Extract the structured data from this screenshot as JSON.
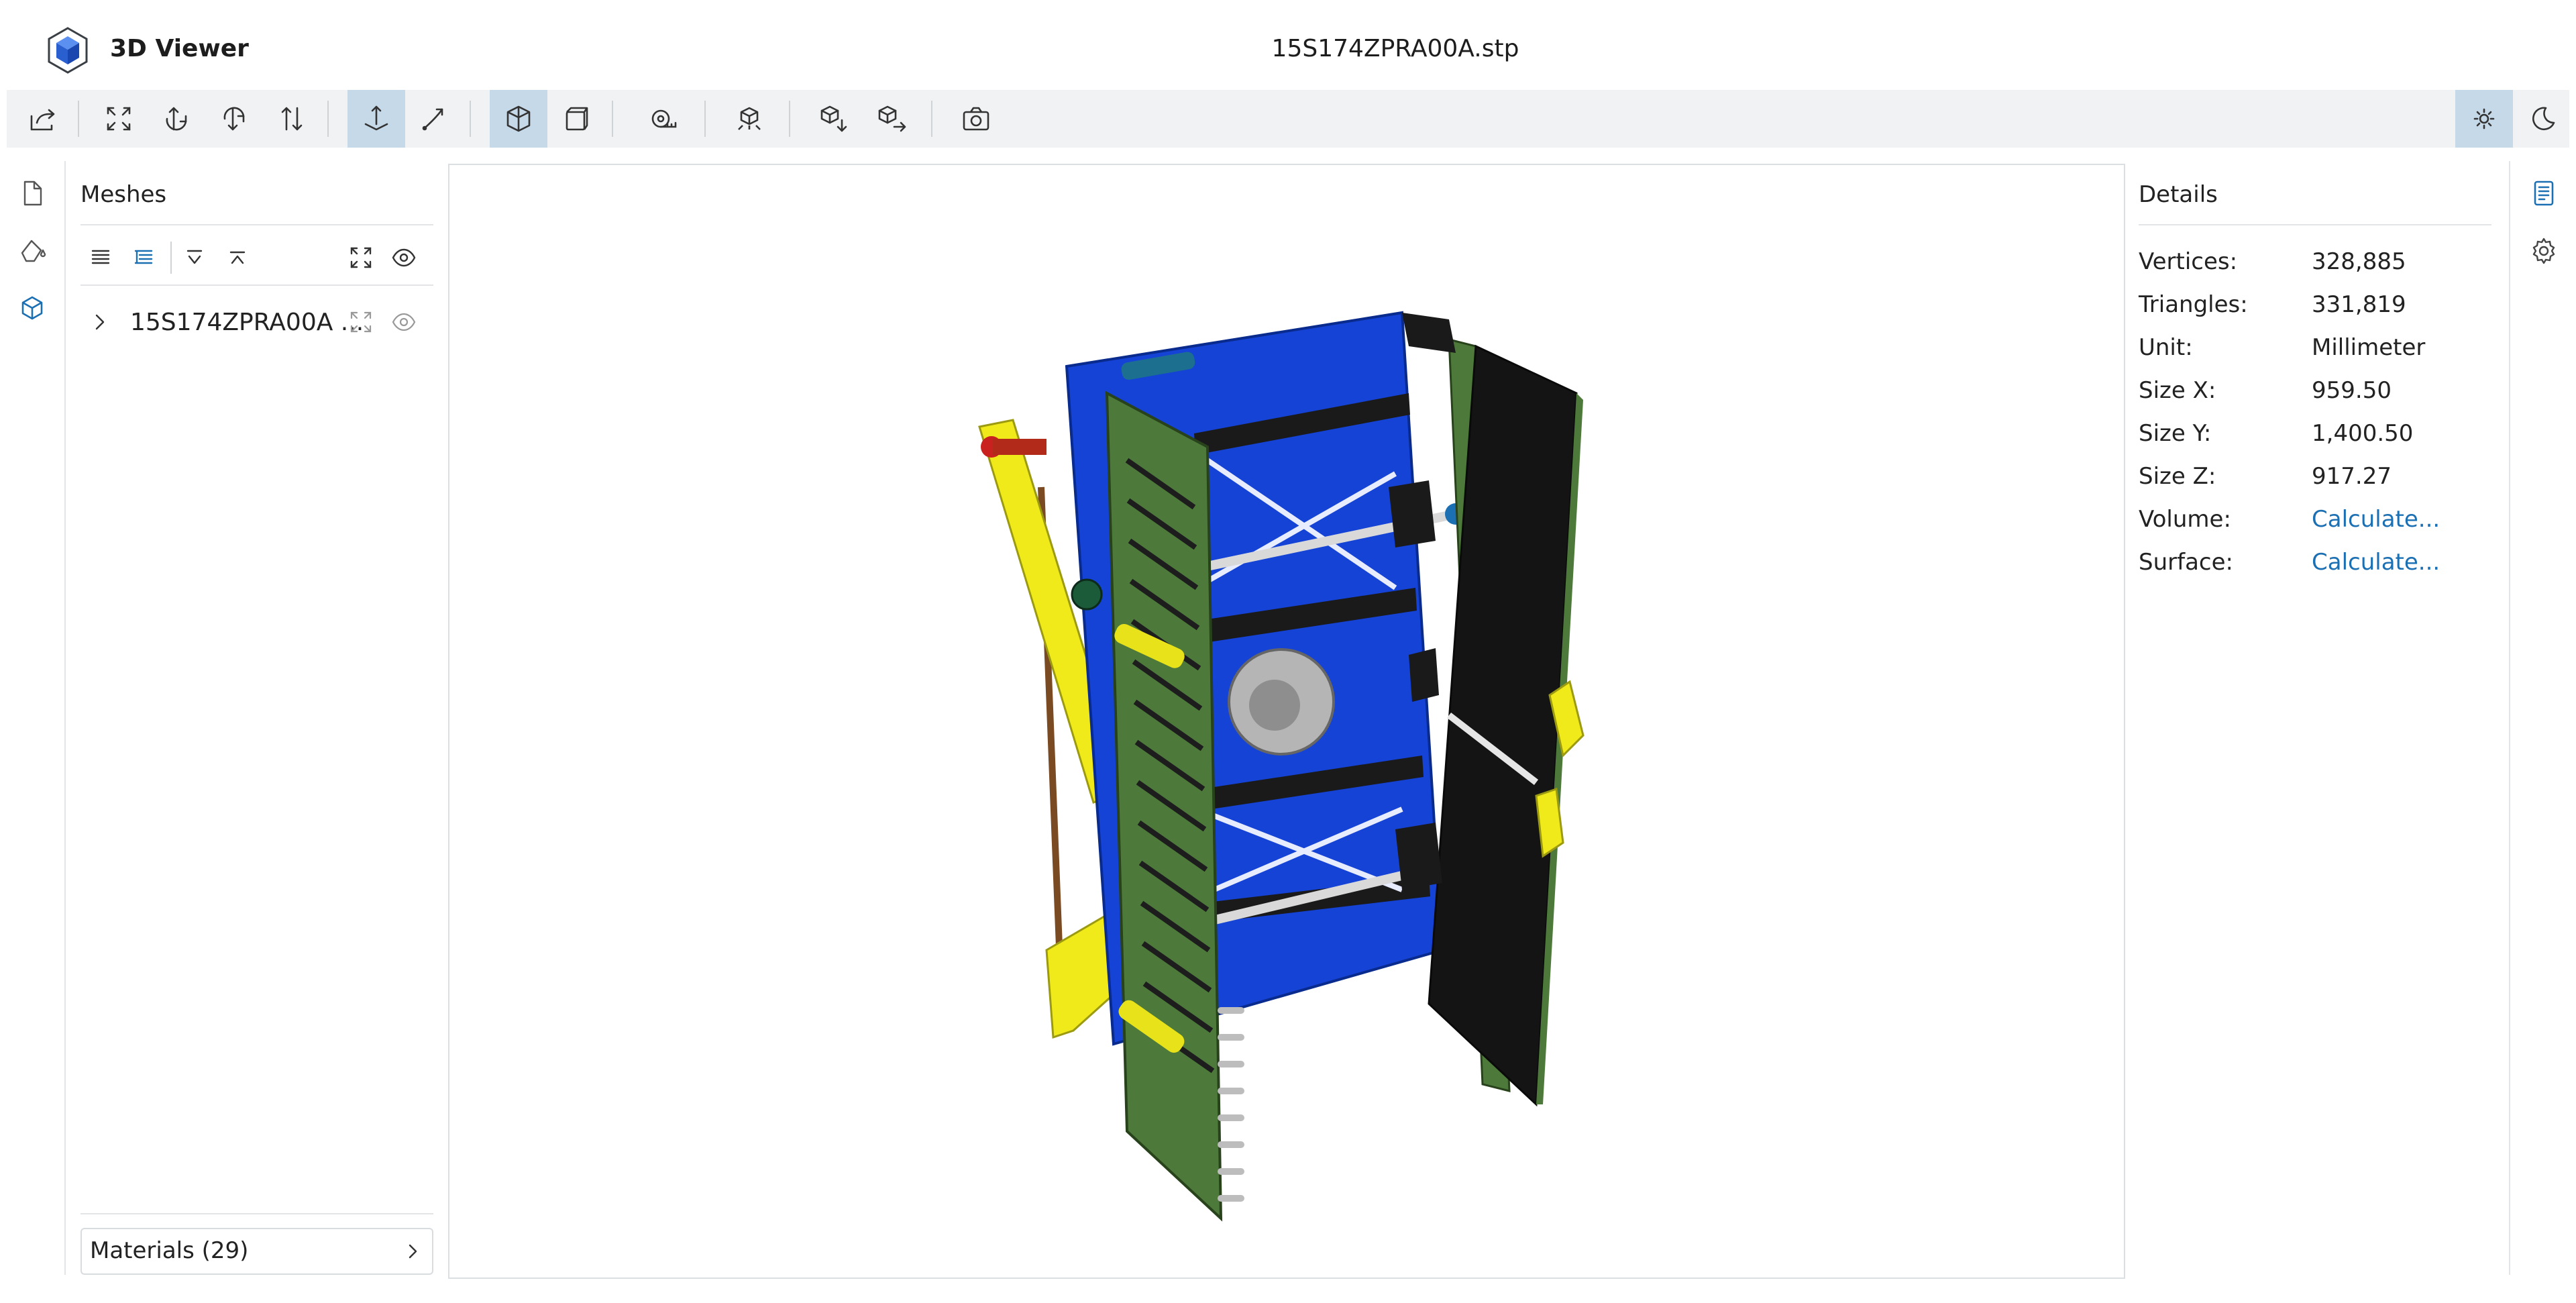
{
  "app": {
    "title": "3D Viewer",
    "file_name": "15S174ZPRA00A.stp"
  },
  "toolbar": {
    "buttons": [
      {
        "icon": "open-file-icon",
        "active": false
      },
      {
        "icon": "fit-to-window-icon",
        "active": false
      },
      {
        "icon": "set-up-vector-icon",
        "active": false
      },
      {
        "icon": "flip-up-vector-icon",
        "active": false
      },
      {
        "icon": "flip-axis-icon",
        "active": false
      },
      {
        "icon": "fixed-up-vector-icon",
        "active": true
      },
      {
        "icon": "free-orbit-icon",
        "active": false
      },
      {
        "icon": "shaded-mode-icon",
        "active": true
      },
      {
        "icon": "lines-mode-icon",
        "active": false
      },
      {
        "icon": "measure-icon",
        "active": false
      },
      {
        "icon": "share-icon",
        "active": false
      },
      {
        "icon": "export-model-icon",
        "active": false
      },
      {
        "icon": "export-selected-icon",
        "active": false
      },
      {
        "icon": "snapshot-icon",
        "active": false
      },
      {
        "icon": "light-theme-icon",
        "active": true
      },
      {
        "icon": "dark-theme-icon",
        "active": false
      }
    ]
  },
  "left_nav": [
    "file-details-icon",
    "materials-nav-icon",
    "meshes-nav-icon"
  ],
  "meshes_panel": {
    "title": "Meshes",
    "tree": [
      {
        "label": "15S174ZPRA00A ...",
        "expanded": false
      }
    ],
    "materials_label": "Materials (29)"
  },
  "details_panel": {
    "title": "Details",
    "rows": [
      {
        "label": "Vertices:",
        "value": "328,885",
        "link": false
      },
      {
        "label": "Triangles:",
        "value": "331,819",
        "link": false
      },
      {
        "label": "Unit:",
        "value": "Millimeter",
        "link": false
      },
      {
        "label": "Size X:",
        "value": "959.50",
        "link": false
      },
      {
        "label": "Size Y:",
        "value": "1,400.50",
        "link": false
      },
      {
        "label": "Size Z:",
        "value": "917.27",
        "link": false
      },
      {
        "label": "Volume:",
        "value": "Calculate...",
        "link": true
      },
      {
        "label": "Surface:",
        "value": "Calculate...",
        "link": true
      }
    ]
  },
  "right_nav": [
    "details-panel-icon",
    "settings-icon"
  ],
  "colors": {
    "accent": "#1b6fb3",
    "active_button_bg": "#c6d9e8",
    "toolbar_bg": "#f1f2f3",
    "model_blue": "#1443d6",
    "model_green": "#4d7a3a",
    "model_yellow": "#f2ee1a",
    "model_black": "#141414"
  }
}
